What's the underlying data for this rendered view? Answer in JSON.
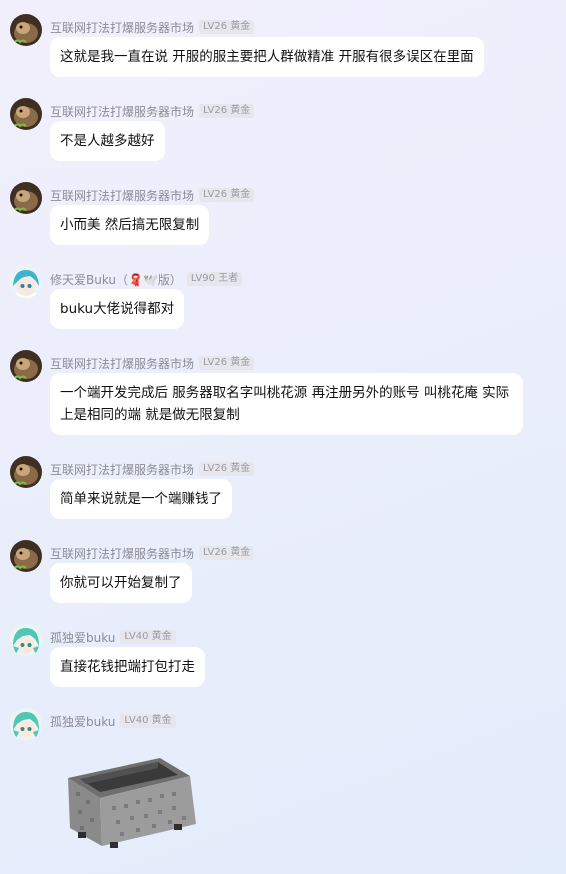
{
  "messages": [
    {
      "sender": "互联网打法打爆服务器市场",
      "level": "LV26 黄金",
      "text": "这就是我一直在说 开服的服主要把人群做精准 开服有很多误区在里面"
    },
    {
      "sender": "互联网打法打爆服务器市场",
      "level": "LV26 黄金",
      "text": "不是人越多越好"
    },
    {
      "sender": "互联网打法打爆服务器市场",
      "level": "LV26 黄金",
      "text": "小而美 然后搞无限复制"
    },
    {
      "sender": "修天爱Buku（🧣🕊️版）",
      "level": "LV90 王者",
      "text": "buku大佬说得都对"
    },
    {
      "sender": "互联网打法打爆服务器市场",
      "level": "LV26 黄金",
      "text": "一个端开发完成后 服务器取名字叫桃花源 再注册另外的账号 叫桃花庵 实际上是相同的端 就是做无限复制"
    },
    {
      "sender": "互联网打法打爆服务器市场",
      "level": "LV26 黄金",
      "text": "简单来说就是一个端赚钱了"
    },
    {
      "sender": "互联网打法打爆服务器市场",
      "level": "LV26 黄金",
      "text": "你就可以开始复制了"
    },
    {
      "sender": "孤独爱buku",
      "level": "LV40 黄金",
      "text": "直接花钱把端打包打走"
    },
    {
      "sender": "孤独爱buku",
      "level": "LV40 黄金",
      "sticker": "minecart-sticker-icon"
    }
  ]
}
